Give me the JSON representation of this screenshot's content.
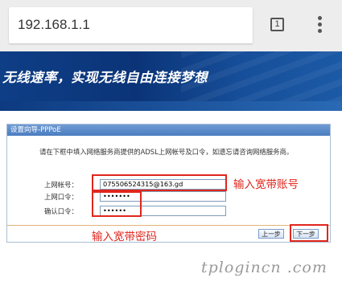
{
  "browser": {
    "url": "192.168.1.1",
    "tab_count": "1",
    "menu_icon": "vertical-dots-icon"
  },
  "banner": {
    "slogan": "无线速率，实现无线自由连接梦想"
  },
  "wizard": {
    "title": "设置向导-PPPoE",
    "description": "请在下框中填入网络服务商提供的ADSL上网帐号及口令，如遗忘请咨询网络服务商。",
    "account_label": "上网帐号：",
    "account_value": "075506524315@163.gd",
    "password_label": "上网口令：",
    "password_value": "•••••••",
    "confirm_label": "确认口令：",
    "confirm_value": "••••••",
    "prev_button": "上一步",
    "next_button": "下一步"
  },
  "annotations": {
    "account_note": "输入宽带账号",
    "password_note": "输入宽带密码",
    "color": "#e0261d"
  },
  "watermark": "tplogincn .com"
}
